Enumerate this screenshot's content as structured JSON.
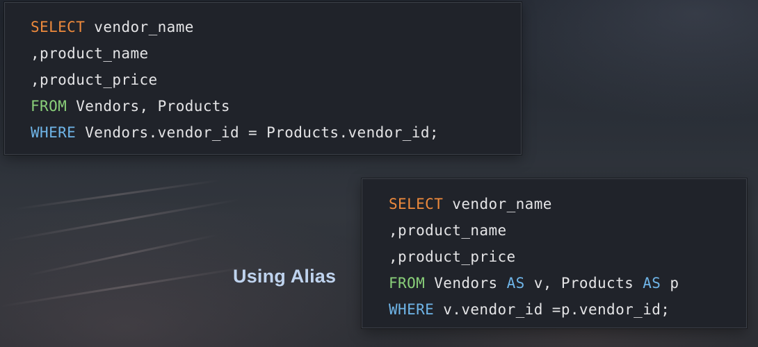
{
  "snippet_plain": {
    "line1": {
      "keyword": "SELECT",
      "rest": " vendor_name"
    },
    "line2": ",product_name",
    "line3": ",product_price",
    "line4": {
      "keyword": "FROM",
      "rest": " Vendors, Products"
    },
    "line5": {
      "keyword": "WHERE",
      "rest": " Vendors.vendor_id = Products.vendor_id;"
    }
  },
  "snippet_alias": {
    "line1": {
      "keyword": "SELECT",
      "rest": " vendor_name"
    },
    "line2": ",product_name",
    "line3": ",product_price",
    "line4": {
      "keyword": "FROM",
      "seg1": " Vendors ",
      "as1": "AS",
      "seg2": " v, Products ",
      "as2": "AS",
      "seg3": " p"
    },
    "line5": {
      "keyword": "WHERE",
      "rest": " v.vendor_id =p.vendor_id;"
    }
  },
  "caption": "Using Alias",
  "colors": {
    "keyword_select": "#ee8a3c",
    "keyword_from": "#8ad07a",
    "keyword_where": "#6fb5e8",
    "caption": "#bfd3ee"
  }
}
